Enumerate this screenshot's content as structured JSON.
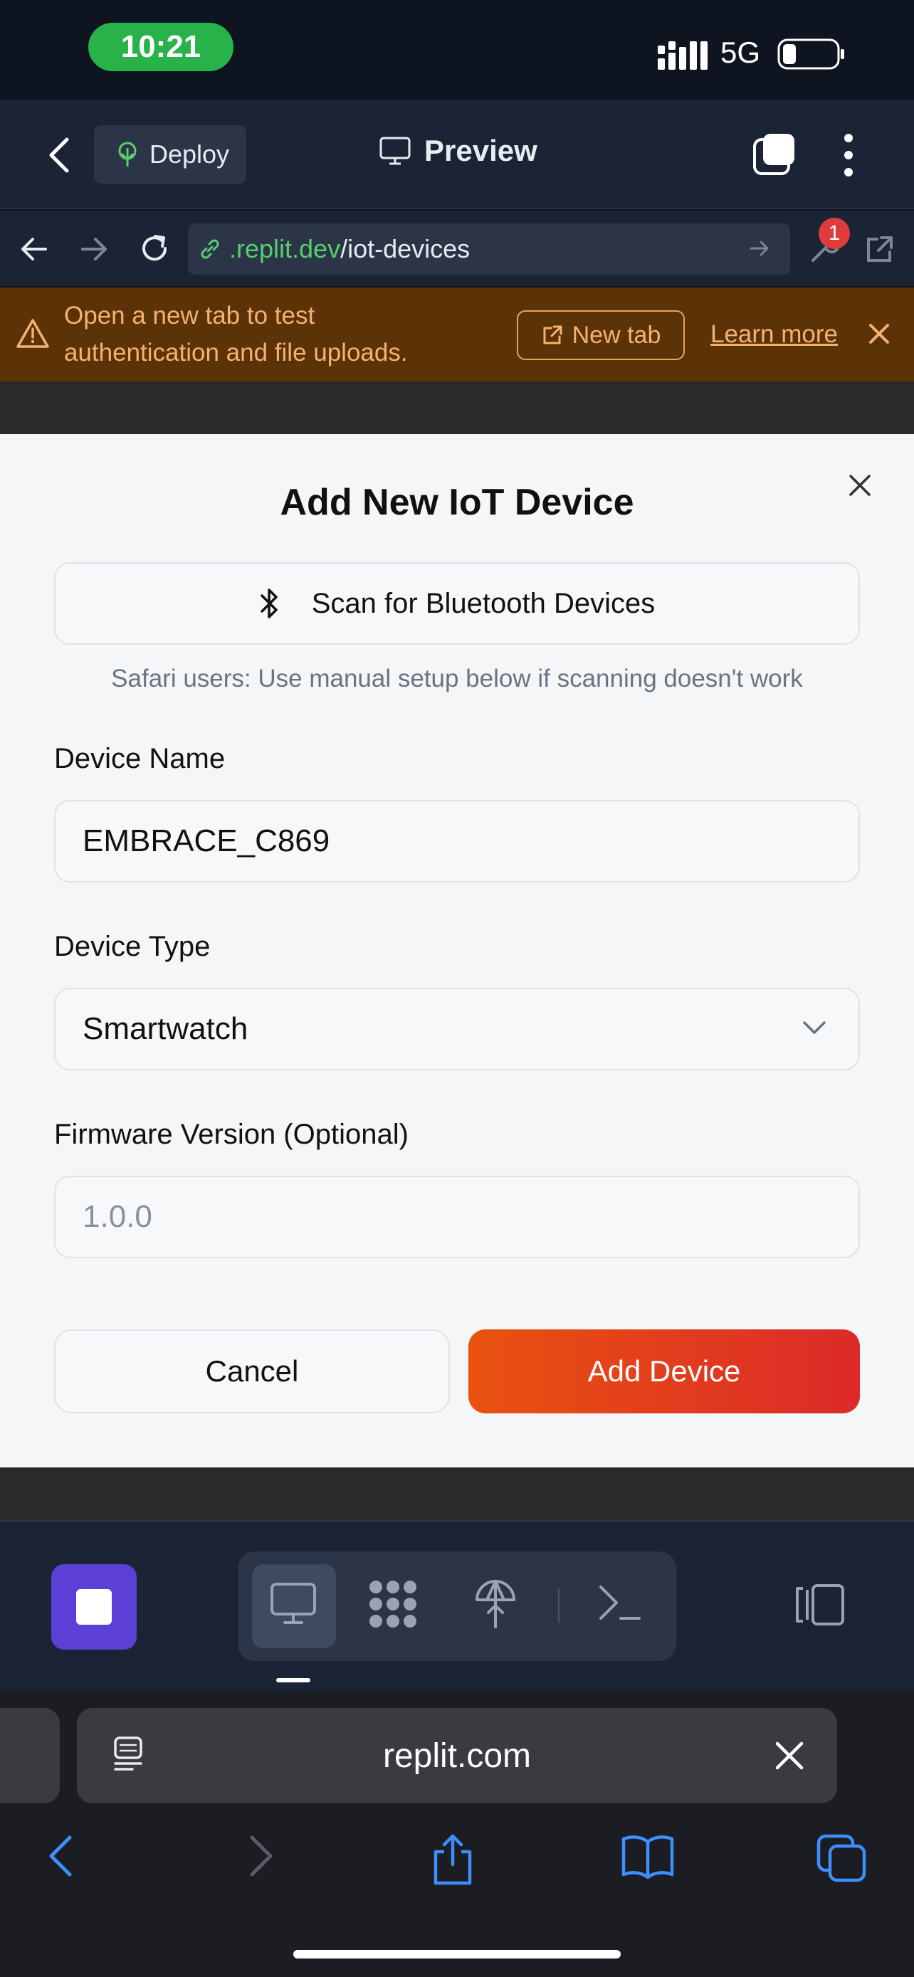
{
  "status_bar": {
    "time": "10:21",
    "network": "5G"
  },
  "replit_header": {
    "deploy_label": "Deploy",
    "title": "Preview"
  },
  "url_bar": {
    "host": ".replit.dev",
    "path": "/iot-devices",
    "badge_count": "1"
  },
  "banner": {
    "message": "Open a new tab to test authentication and file uploads.",
    "new_tab_label": "New tab",
    "learn_more_label": "Learn more"
  },
  "modal": {
    "title": "Add New IoT Device",
    "scan_label": "Scan for Bluetooth Devices",
    "safari_note": "Safari users: Use manual setup below if scanning doesn't work",
    "device_name_label": "Device Name",
    "device_name_value": "EMBRACE_C869",
    "device_type_label": "Device Type",
    "device_type_value": "Smartwatch",
    "firmware_label": "Firmware Version (Optional)",
    "firmware_placeholder": "1.0.0",
    "cancel_label": "Cancel",
    "add_label": "Add Device"
  },
  "safari": {
    "address": "replit.com"
  },
  "colors": {
    "accent_orange": "#e9520f",
    "accent_red": "#dc2a2a",
    "run_purple": "#5b3fd6",
    "link_green": "#55d06d"
  }
}
